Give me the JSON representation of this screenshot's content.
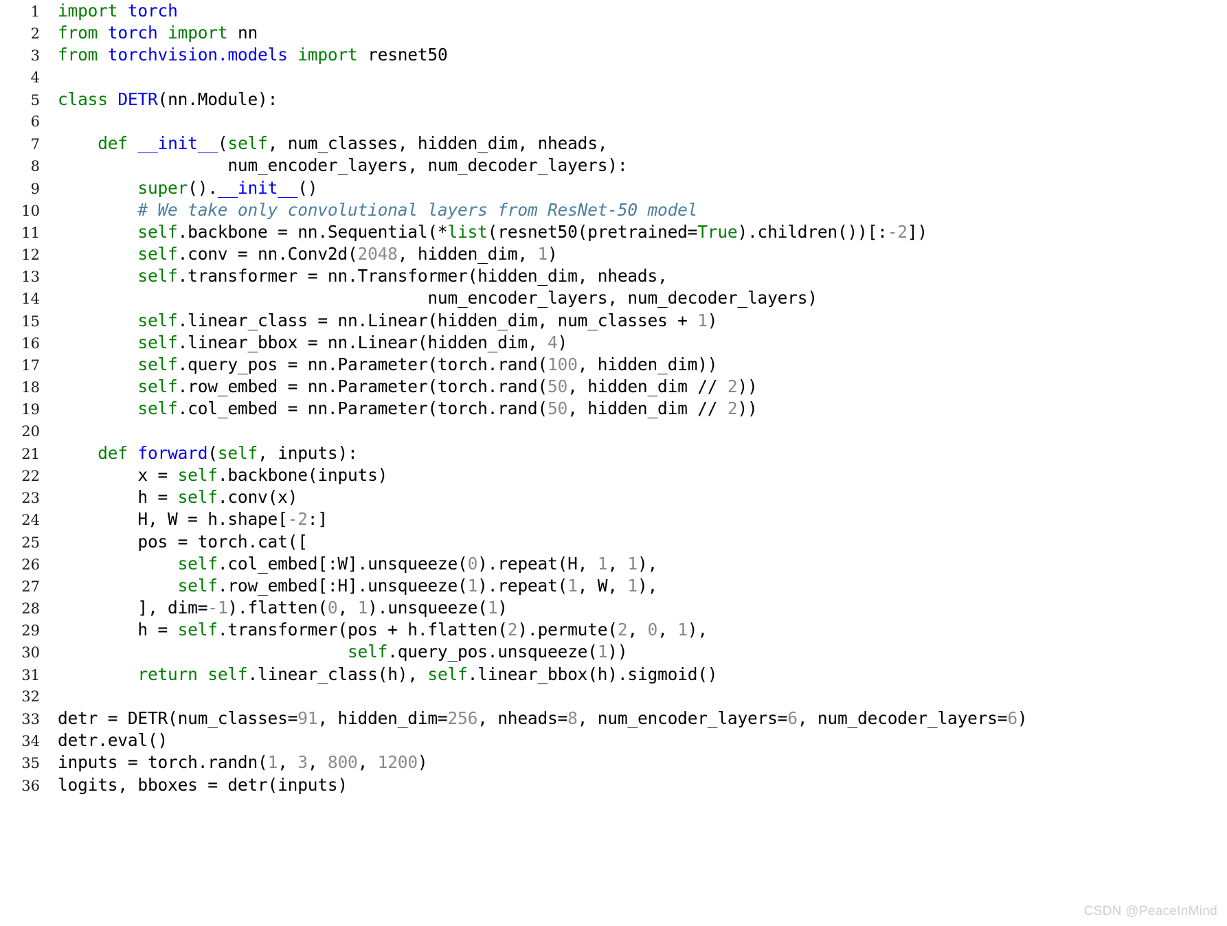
{
  "editor": {
    "language": "python",
    "background_color": "#ffffff",
    "theme_colors": {
      "keyword": "#007f00",
      "definition_name": "#0000f0",
      "number": "#8a8a8a",
      "comment": "#4a7f9e",
      "plain_text": "#000000",
      "line_number": "#1b1b1b"
    },
    "first_line_number": 1,
    "last_line_number": 36,
    "line_numbers": [
      "1",
      "2",
      "3",
      "4",
      "5",
      "6",
      "7",
      "8",
      "9",
      "10",
      "11",
      "12",
      "13",
      "14",
      "15",
      "16",
      "17",
      "18",
      "19",
      "20",
      "21",
      "22",
      "23",
      "24",
      "25",
      "26",
      "27",
      "28",
      "29",
      "30",
      "31",
      "32",
      "33",
      "34",
      "35",
      "36"
    ],
    "lines": [
      {
        "number": "1",
        "tokens": [
          {
            "t": "import",
            "c": "kw"
          },
          {
            "t": " ",
            "c": "plain"
          },
          {
            "t": "torch",
            "c": "def"
          }
        ]
      },
      {
        "number": "2",
        "tokens": [
          {
            "t": "from",
            "c": "kw"
          },
          {
            "t": " ",
            "c": "plain"
          },
          {
            "t": "torch",
            "c": "def"
          },
          {
            "t": " ",
            "c": "plain"
          },
          {
            "t": "import",
            "c": "kw"
          },
          {
            "t": " nn",
            "c": "plain"
          }
        ]
      },
      {
        "number": "3",
        "tokens": [
          {
            "t": "from",
            "c": "kw"
          },
          {
            "t": " ",
            "c": "plain"
          },
          {
            "t": "torchvision.models",
            "c": "def"
          },
          {
            "t": " ",
            "c": "plain"
          },
          {
            "t": "import",
            "c": "kw"
          },
          {
            "t": " resnet50",
            "c": "plain"
          }
        ]
      },
      {
        "number": "4",
        "tokens": []
      },
      {
        "number": "5",
        "tokens": [
          {
            "t": "class",
            "c": "kw"
          },
          {
            "t": " ",
            "c": "plain"
          },
          {
            "t": "DETR",
            "c": "def"
          },
          {
            "t": "(nn.Module):",
            "c": "plain"
          }
        ]
      },
      {
        "number": "6",
        "tokens": []
      },
      {
        "number": "7",
        "tokens": [
          {
            "t": "    ",
            "c": "plain"
          },
          {
            "t": "def",
            "c": "kw"
          },
          {
            "t": " ",
            "c": "plain"
          },
          {
            "t": "__init__",
            "c": "def"
          },
          {
            "t": "(",
            "c": "plain"
          },
          {
            "t": "self",
            "c": "self"
          },
          {
            "t": ", num_classes, hidden_dim, nheads,",
            "c": "plain"
          }
        ]
      },
      {
        "number": "8",
        "tokens": [
          {
            "t": "                 num_encoder_layers, num_decoder_layers):",
            "c": "plain"
          }
        ]
      },
      {
        "number": "9",
        "tokens": [
          {
            "t": "        ",
            "c": "plain"
          },
          {
            "t": "super",
            "c": "builtin"
          },
          {
            "t": "().",
            "c": "plain"
          },
          {
            "t": "__init__",
            "c": "def"
          },
          {
            "t": "()",
            "c": "plain"
          }
        ]
      },
      {
        "number": "10",
        "tokens": [
          {
            "t": "        ",
            "c": "plain"
          },
          {
            "t": "# We take only convolutional layers from ResNet-50 model",
            "c": "comment"
          }
        ]
      },
      {
        "number": "11",
        "tokens": [
          {
            "t": "        ",
            "c": "plain"
          },
          {
            "t": "self",
            "c": "self"
          },
          {
            "t": ".backbone = nn.Sequential(*",
            "c": "plain"
          },
          {
            "t": "list",
            "c": "builtin"
          },
          {
            "t": "(resnet50(pretrained=",
            "c": "plain"
          },
          {
            "t": "True",
            "c": "kw"
          },
          {
            "t": ").children())[:",
            "c": "plain"
          },
          {
            "t": "-2",
            "c": "num"
          },
          {
            "t": "])",
            "c": "plain"
          }
        ]
      },
      {
        "number": "12",
        "tokens": [
          {
            "t": "        ",
            "c": "plain"
          },
          {
            "t": "self",
            "c": "self"
          },
          {
            "t": ".conv = nn.Conv2d(",
            "c": "plain"
          },
          {
            "t": "2048",
            "c": "num"
          },
          {
            "t": ", hidden_dim, ",
            "c": "plain"
          },
          {
            "t": "1",
            "c": "num"
          },
          {
            "t": ")",
            "c": "plain"
          }
        ]
      },
      {
        "number": "13",
        "tokens": [
          {
            "t": "        ",
            "c": "plain"
          },
          {
            "t": "self",
            "c": "self"
          },
          {
            "t": ".transformer = nn.Transformer(hidden_dim, nheads,",
            "c": "plain"
          }
        ]
      },
      {
        "number": "14",
        "tokens": [
          {
            "t": "                                     num_encoder_layers, num_decoder_layers)",
            "c": "plain"
          }
        ]
      },
      {
        "number": "15",
        "tokens": [
          {
            "t": "        ",
            "c": "plain"
          },
          {
            "t": "self",
            "c": "self"
          },
          {
            "t": ".linear_class = nn.Linear(hidden_dim, num_classes + ",
            "c": "plain"
          },
          {
            "t": "1",
            "c": "num"
          },
          {
            "t": ")",
            "c": "plain"
          }
        ]
      },
      {
        "number": "16",
        "tokens": [
          {
            "t": "        ",
            "c": "plain"
          },
          {
            "t": "self",
            "c": "self"
          },
          {
            "t": ".linear_bbox = nn.Linear(hidden_dim, ",
            "c": "plain"
          },
          {
            "t": "4",
            "c": "num"
          },
          {
            "t": ")",
            "c": "plain"
          }
        ]
      },
      {
        "number": "17",
        "tokens": [
          {
            "t": "        ",
            "c": "plain"
          },
          {
            "t": "self",
            "c": "self"
          },
          {
            "t": ".query_pos = nn.Parameter(torch.rand(",
            "c": "plain"
          },
          {
            "t": "100",
            "c": "num"
          },
          {
            "t": ", hidden_dim))",
            "c": "plain"
          }
        ]
      },
      {
        "number": "18",
        "tokens": [
          {
            "t": "        ",
            "c": "plain"
          },
          {
            "t": "self",
            "c": "self"
          },
          {
            "t": ".row_embed = nn.Parameter(torch.rand(",
            "c": "plain"
          },
          {
            "t": "50",
            "c": "num"
          },
          {
            "t": ", hidden_dim // ",
            "c": "plain"
          },
          {
            "t": "2",
            "c": "num"
          },
          {
            "t": "))",
            "c": "plain"
          }
        ]
      },
      {
        "number": "19",
        "tokens": [
          {
            "t": "        ",
            "c": "plain"
          },
          {
            "t": "self",
            "c": "self"
          },
          {
            "t": ".col_embed = nn.Parameter(torch.rand(",
            "c": "plain"
          },
          {
            "t": "50",
            "c": "num"
          },
          {
            "t": ", hidden_dim // ",
            "c": "plain"
          },
          {
            "t": "2",
            "c": "num"
          },
          {
            "t": "))",
            "c": "plain"
          }
        ]
      },
      {
        "number": "20",
        "tokens": []
      },
      {
        "number": "21",
        "tokens": [
          {
            "t": "    ",
            "c": "plain"
          },
          {
            "t": "def",
            "c": "kw"
          },
          {
            "t": " ",
            "c": "plain"
          },
          {
            "t": "forward",
            "c": "def"
          },
          {
            "t": "(",
            "c": "plain"
          },
          {
            "t": "self",
            "c": "self"
          },
          {
            "t": ", inputs):",
            "c": "plain"
          }
        ]
      },
      {
        "number": "22",
        "tokens": [
          {
            "t": "        x = ",
            "c": "plain"
          },
          {
            "t": "self",
            "c": "self"
          },
          {
            "t": ".backbone(inputs)",
            "c": "plain"
          }
        ]
      },
      {
        "number": "23",
        "tokens": [
          {
            "t": "        h = ",
            "c": "plain"
          },
          {
            "t": "self",
            "c": "self"
          },
          {
            "t": ".conv(x)",
            "c": "plain"
          }
        ]
      },
      {
        "number": "24",
        "tokens": [
          {
            "t": "        H, W = h.shape[",
            "c": "plain"
          },
          {
            "t": "-2",
            "c": "num"
          },
          {
            "t": ":]",
            "c": "plain"
          }
        ]
      },
      {
        "number": "25",
        "tokens": [
          {
            "t": "        pos = torch.cat([",
            "c": "plain"
          }
        ]
      },
      {
        "number": "26",
        "tokens": [
          {
            "t": "            ",
            "c": "plain"
          },
          {
            "t": "self",
            "c": "self"
          },
          {
            "t": ".col_embed[:W].unsqueeze(",
            "c": "plain"
          },
          {
            "t": "0",
            "c": "num"
          },
          {
            "t": ").repeat(H, ",
            "c": "plain"
          },
          {
            "t": "1",
            "c": "num"
          },
          {
            "t": ", ",
            "c": "plain"
          },
          {
            "t": "1",
            "c": "num"
          },
          {
            "t": "),",
            "c": "plain"
          }
        ]
      },
      {
        "number": "27",
        "tokens": [
          {
            "t": "            ",
            "c": "plain"
          },
          {
            "t": "self",
            "c": "self"
          },
          {
            "t": ".row_embed[:H].unsqueeze(",
            "c": "plain"
          },
          {
            "t": "1",
            "c": "num"
          },
          {
            "t": ").repeat(",
            "c": "plain"
          },
          {
            "t": "1",
            "c": "num"
          },
          {
            "t": ", W, ",
            "c": "plain"
          },
          {
            "t": "1",
            "c": "num"
          },
          {
            "t": "),",
            "c": "plain"
          }
        ]
      },
      {
        "number": "28",
        "tokens": [
          {
            "t": "        ], dim=",
            "c": "plain"
          },
          {
            "t": "-1",
            "c": "num"
          },
          {
            "t": ").flatten(",
            "c": "plain"
          },
          {
            "t": "0",
            "c": "num"
          },
          {
            "t": ", ",
            "c": "plain"
          },
          {
            "t": "1",
            "c": "num"
          },
          {
            "t": ").unsqueeze(",
            "c": "plain"
          },
          {
            "t": "1",
            "c": "num"
          },
          {
            "t": ")",
            "c": "plain"
          }
        ]
      },
      {
        "number": "29",
        "tokens": [
          {
            "t": "        h = ",
            "c": "plain"
          },
          {
            "t": "self",
            "c": "self"
          },
          {
            "t": ".transformer(pos + h.flatten(",
            "c": "plain"
          },
          {
            "t": "2",
            "c": "num"
          },
          {
            "t": ").permute(",
            "c": "plain"
          },
          {
            "t": "2",
            "c": "num"
          },
          {
            "t": ", ",
            "c": "plain"
          },
          {
            "t": "0",
            "c": "num"
          },
          {
            "t": ", ",
            "c": "plain"
          },
          {
            "t": "1",
            "c": "num"
          },
          {
            "t": "),",
            "c": "plain"
          }
        ]
      },
      {
        "number": "30",
        "tokens": [
          {
            "t": "                             ",
            "c": "plain"
          },
          {
            "t": "self",
            "c": "self"
          },
          {
            "t": ".query_pos.unsqueeze(",
            "c": "plain"
          },
          {
            "t": "1",
            "c": "num"
          },
          {
            "t": "))",
            "c": "plain"
          }
        ]
      },
      {
        "number": "31",
        "tokens": [
          {
            "t": "        ",
            "c": "plain"
          },
          {
            "t": "return",
            "c": "kw"
          },
          {
            "t": " ",
            "c": "plain"
          },
          {
            "t": "self",
            "c": "self"
          },
          {
            "t": ".linear_class(h), ",
            "c": "plain"
          },
          {
            "t": "self",
            "c": "self"
          },
          {
            "t": ".linear_bbox(h).sigmoid()",
            "c": "plain"
          }
        ]
      },
      {
        "number": "32",
        "tokens": []
      },
      {
        "number": "33",
        "tokens": [
          {
            "t": "detr = DETR(num_classes=",
            "c": "plain"
          },
          {
            "t": "91",
            "c": "num"
          },
          {
            "t": ", hidden_dim=",
            "c": "plain"
          },
          {
            "t": "256",
            "c": "num"
          },
          {
            "t": ", nheads=",
            "c": "plain"
          },
          {
            "t": "8",
            "c": "num"
          },
          {
            "t": ", num_encoder_layers=",
            "c": "plain"
          },
          {
            "t": "6",
            "c": "num"
          },
          {
            "t": ", num_decoder_layers=",
            "c": "plain"
          },
          {
            "t": "6",
            "c": "num"
          },
          {
            "t": ")",
            "c": "plain"
          }
        ]
      },
      {
        "number": "34",
        "tokens": [
          {
            "t": "detr.eval()",
            "c": "plain"
          }
        ]
      },
      {
        "number": "35",
        "tokens": [
          {
            "t": "inputs = torch.randn(",
            "c": "plain"
          },
          {
            "t": "1",
            "c": "num"
          },
          {
            "t": ", ",
            "c": "plain"
          },
          {
            "t": "3",
            "c": "num"
          },
          {
            "t": ", ",
            "c": "plain"
          },
          {
            "t": "800",
            "c": "num"
          },
          {
            "t": ", ",
            "c": "plain"
          },
          {
            "t": "1200",
            "c": "num"
          },
          {
            "t": ")",
            "c": "plain"
          }
        ]
      },
      {
        "number": "36",
        "tokens": [
          {
            "t": "logits, bboxes = detr(inputs)",
            "c": "plain"
          }
        ]
      }
    ]
  },
  "watermark": {
    "text": "CSDN @PeaceInMind"
  }
}
